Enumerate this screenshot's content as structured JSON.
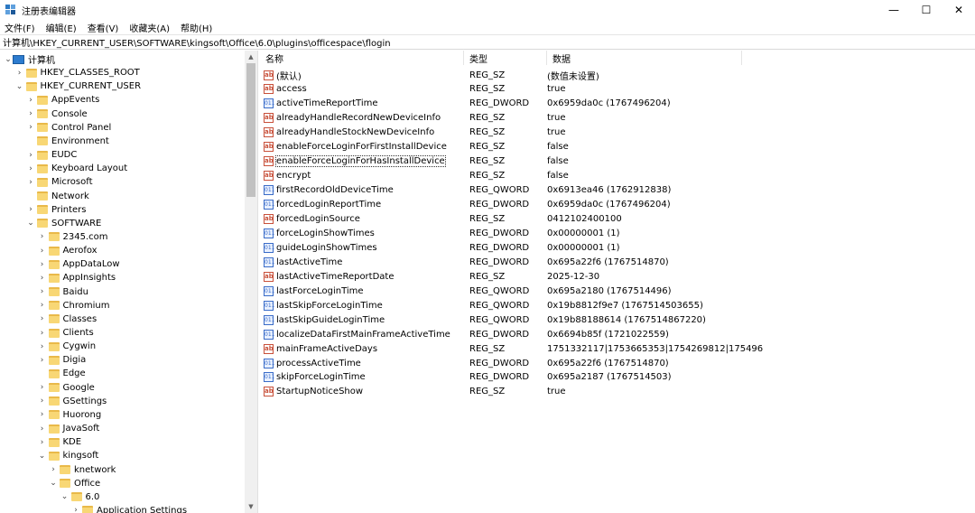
{
  "window": {
    "title": "注册表编辑器",
    "controls": {
      "minimize": "—",
      "maximize": "☐",
      "close": "✕"
    }
  },
  "menu": [
    "文件(F)",
    "编辑(E)",
    "查看(V)",
    "收藏夹(A)",
    "帮助(H)"
  ],
  "address": "计算机\\HKEY_CURRENT_USER\\SOFTWARE\\kingsoft\\Office\\6.0\\plugins\\officespace\\flogin",
  "tree": [
    {
      "label": "计算机",
      "level": 0,
      "expanded": true,
      "icon": "computer-icon"
    },
    {
      "label": "HKEY_CLASSES_ROOT",
      "level": 1,
      "expanded": false
    },
    {
      "label": "HKEY_CURRENT_USER",
      "level": 1,
      "expanded": true
    },
    {
      "label": "AppEvents",
      "level": 2,
      "expanded": false
    },
    {
      "label": "Console",
      "level": 2,
      "expanded": false
    },
    {
      "label": "Control Panel",
      "level": 2,
      "expanded": false
    },
    {
      "label": "Environment",
      "level": 2,
      "leaf": true
    },
    {
      "label": "EUDC",
      "level": 2,
      "expanded": false
    },
    {
      "label": "Keyboard Layout",
      "level": 2,
      "expanded": false
    },
    {
      "label": "Microsoft",
      "level": 2,
      "expanded": false
    },
    {
      "label": "Network",
      "level": 2,
      "leaf": true
    },
    {
      "label": "Printers",
      "level": 2,
      "expanded": false
    },
    {
      "label": "SOFTWARE",
      "level": 2,
      "expanded": true
    },
    {
      "label": "2345.com",
      "level": 3,
      "expanded": false
    },
    {
      "label": "Aerofox",
      "level": 3,
      "expanded": false
    },
    {
      "label": "AppDataLow",
      "level": 3,
      "expanded": false
    },
    {
      "label": "AppInsights",
      "level": 3,
      "expanded": false
    },
    {
      "label": "Baidu",
      "level": 3,
      "expanded": false
    },
    {
      "label": "Chromium",
      "level": 3,
      "expanded": false
    },
    {
      "label": "Classes",
      "level": 3,
      "expanded": false
    },
    {
      "label": "Clients",
      "level": 3,
      "expanded": false
    },
    {
      "label": "Cygwin",
      "level": 3,
      "expanded": false
    },
    {
      "label": "Digia",
      "level": 3,
      "expanded": false
    },
    {
      "label": "Edge",
      "level": 3,
      "leaf": true
    },
    {
      "label": "Google",
      "level": 3,
      "expanded": false
    },
    {
      "label": "GSettings",
      "level": 3,
      "expanded": false
    },
    {
      "label": "Huorong",
      "level": 3,
      "expanded": false
    },
    {
      "label": "JavaSoft",
      "level": 3,
      "expanded": false
    },
    {
      "label": "KDE",
      "level": 3,
      "expanded": false
    },
    {
      "label": "kingsoft",
      "level": 3,
      "expanded": true
    },
    {
      "label": "knetwork",
      "level": 4,
      "expanded": false
    },
    {
      "label": "Office",
      "level": 4,
      "expanded": true
    },
    {
      "label": "6.0",
      "level": 5,
      "expanded": true
    },
    {
      "label": "Application Settings",
      "level": 6,
      "expanded": false
    }
  ],
  "list": {
    "headers": {
      "name": "名称",
      "type": "类型",
      "data": "数据"
    },
    "rows": [
      {
        "name": "(默认)",
        "type": "REG_SZ",
        "data": "(数值未设置)",
        "kind": "sz"
      },
      {
        "name": "access",
        "type": "REG_SZ",
        "data": "true",
        "kind": "sz"
      },
      {
        "name": "activeTimeReportTime",
        "type": "REG_DWORD",
        "data": "0x6959da0c (1767496204)",
        "kind": "bin"
      },
      {
        "name": "alreadyHandleRecordNewDeviceInfo",
        "type": "REG_SZ",
        "data": "true",
        "kind": "sz"
      },
      {
        "name": "alreadyHandleStockNewDeviceInfo",
        "type": "REG_SZ",
        "data": "true",
        "kind": "sz"
      },
      {
        "name": "enableForceLoginForFirstInstallDevice",
        "type": "REG_SZ",
        "data": "false",
        "kind": "sz"
      },
      {
        "name": "enableForceLoginForHasInstallDevice",
        "type": "REG_SZ",
        "data": "false",
        "kind": "sz",
        "focused": true
      },
      {
        "name": "encrypt",
        "type": "REG_SZ",
        "data": "false",
        "kind": "sz"
      },
      {
        "name": "firstRecordOldDeviceTime",
        "type": "REG_QWORD",
        "data": "0x6913ea46 (1762912838)",
        "kind": "bin"
      },
      {
        "name": "forcedLoginReportTime",
        "type": "REG_DWORD",
        "data": "0x6959da0c (1767496204)",
        "kind": "bin"
      },
      {
        "name": "forcedLoginSource",
        "type": "REG_SZ",
        "data": "0412102400100",
        "kind": "sz"
      },
      {
        "name": "forceLoginShowTimes",
        "type": "REG_DWORD",
        "data": "0x00000001 (1)",
        "kind": "bin"
      },
      {
        "name": "guideLoginShowTimes",
        "type": "REG_DWORD",
        "data": "0x00000001 (1)",
        "kind": "bin"
      },
      {
        "name": "lastActiveTime",
        "type": "REG_DWORD",
        "data": "0x695a22f6 (1767514870)",
        "kind": "bin"
      },
      {
        "name": "lastActiveTimeReportDate",
        "type": "REG_SZ",
        "data": "2025-12-30",
        "kind": "sz"
      },
      {
        "name": "lastForceLoginTime",
        "type": "REG_QWORD",
        "data": "0x695a2180 (1767514496)",
        "kind": "bin"
      },
      {
        "name": "lastSkipForceLoginTime",
        "type": "REG_QWORD",
        "data": "0x19b8812f9e7 (1767514503655)",
        "kind": "bin"
      },
      {
        "name": "lastSkipGuideLoginTime",
        "type": "REG_QWORD",
        "data": "0x19b88188614 (1767514867220)",
        "kind": "bin"
      },
      {
        "name": "localizeDataFirstMainFrameActiveTime",
        "type": "REG_DWORD",
        "data": "0x6694b85f (1721022559)",
        "kind": "bin"
      },
      {
        "name": "mainFrameActiveDays",
        "type": "REG_SZ",
        "data": "1751332117|1753665353|1754269812|175496...",
        "kind": "sz"
      },
      {
        "name": "processActiveTime",
        "type": "REG_DWORD",
        "data": "0x695a22f6 (1767514870)",
        "kind": "bin"
      },
      {
        "name": "skipForceLoginTime",
        "type": "REG_DWORD",
        "data": "0x695a2187 (1767514503)",
        "kind": "bin"
      },
      {
        "name": "StartupNoticeShow",
        "type": "REG_SZ",
        "data": "true",
        "kind": "sz"
      }
    ]
  }
}
